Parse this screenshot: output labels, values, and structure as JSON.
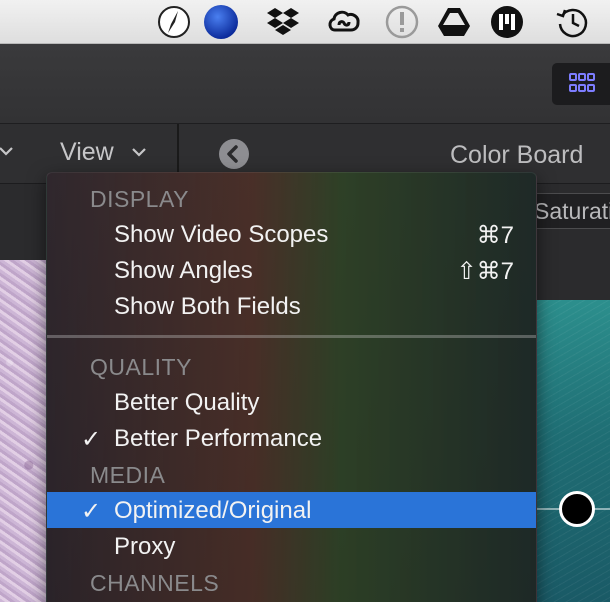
{
  "menubar": {
    "icons": [
      "compass-icon",
      "blue-ball-icon",
      "dropbox-icon",
      "creative-cloud-icon",
      "alert-icon",
      "drive-icon",
      "m-app-icon",
      "time-machine-icon"
    ]
  },
  "viewer": {
    "view_menu_title": "View",
    "color_board_title": "Color Board",
    "saturation_tab": "Saturation"
  },
  "menu": {
    "sections": {
      "display": "DISPLAY",
      "quality": "QUALITY",
      "media": "MEDIA",
      "channels": "CHANNELS"
    },
    "items": [
      {
        "label": "Show Video Scopes",
        "shortcut": "⌘7",
        "checked": false,
        "selected": false
      },
      {
        "label": "Show Angles",
        "shortcut": "⇧⌘7",
        "checked": false,
        "selected": false
      },
      {
        "label": "Show Both Fields",
        "shortcut": "",
        "checked": false,
        "selected": false
      },
      {
        "label": "Better Quality",
        "shortcut": "",
        "checked": false,
        "selected": false
      },
      {
        "label": "Better Performance",
        "shortcut": "",
        "checked": true,
        "selected": false
      },
      {
        "label": "Optimized/Original",
        "shortcut": "",
        "checked": true,
        "selected": true
      },
      {
        "label": "Proxy",
        "shortcut": "",
        "checked": false,
        "selected": false
      }
    ],
    "check_glyph": "✓"
  },
  "colors": {
    "selection": "#2a74d8",
    "colorboard_teal": "#2c8f8d"
  }
}
